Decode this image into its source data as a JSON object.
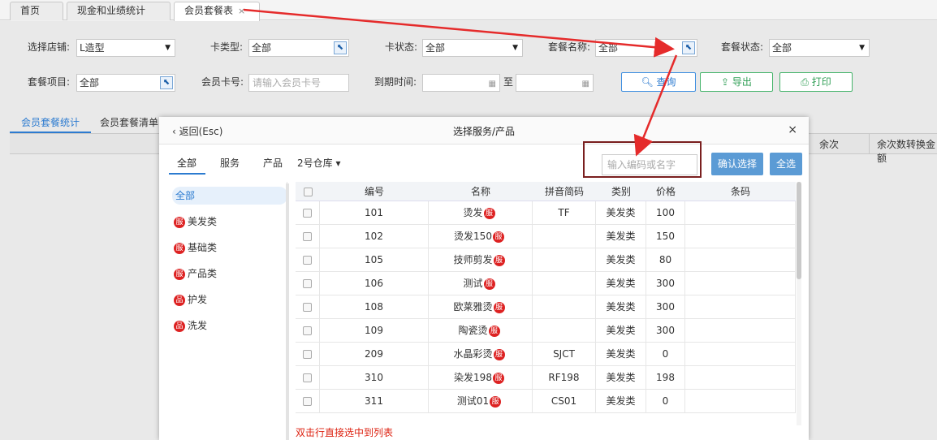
{
  "tabs": [
    {
      "label": "首页"
    },
    {
      "label": "现金和业绩统计"
    },
    {
      "label": "会员套餐表",
      "close": "×"
    }
  ],
  "filters": {
    "store_label": "选择店铺:",
    "store_value": "L造型",
    "card_type_label": "卡类型:",
    "card_type_value": "全部",
    "card_status_label": "卡状态:",
    "card_status_value": "全部",
    "package_name_label": "套餐名称:",
    "package_name_value": "全部",
    "package_status_label": "套餐状态:",
    "package_status_value": "全部",
    "package_item_label": "套餐项目:",
    "package_item_value": "全部",
    "card_no_label": "会员卡号:",
    "card_no_placeholder": "请输入会员卡号",
    "expire_label": "到期时间:",
    "to_label": "至"
  },
  "buttons": {
    "query": "查询",
    "export": "导出",
    "print": "打印"
  },
  "subtabs": [
    "会员套餐统计",
    "会员套餐清单"
  ],
  "bg_table_headers": [
    "余次",
    "余次数转换金额"
  ],
  "dialog": {
    "back": "返回(Esc)",
    "title": "选择服务/产品",
    "close": "×",
    "filter_tabs": [
      "全部",
      "服务",
      "产品"
    ],
    "warehouse": "2号仓库 ▾",
    "search_placeholder": "输入编码或名字",
    "confirm": "确认选择",
    "select_all": "全选",
    "categories": [
      {
        "label": "全部",
        "badge": ""
      },
      {
        "label": "美发类",
        "badge": "服"
      },
      {
        "label": "基础类",
        "badge": "服"
      },
      {
        "label": "产品类",
        "badge": "服"
      },
      {
        "label": "护发",
        "badge": "品"
      },
      {
        "label": "洗发",
        "badge": "品"
      }
    ],
    "columns": [
      "编号",
      "名称",
      "拼音简码",
      "类别",
      "价格",
      "条码"
    ],
    "rows": [
      {
        "code": "101",
        "name": "烫发",
        "badge": "服",
        "pinyin": "TF",
        "category": "美发类",
        "price": "100"
      },
      {
        "code": "102",
        "name": "烫发150",
        "badge": "服",
        "pinyin": "",
        "category": "美发类",
        "price": "150"
      },
      {
        "code": "105",
        "name": "技师剪发",
        "badge": "服",
        "pinyin": "",
        "category": "美发类",
        "price": "80"
      },
      {
        "code": "106",
        "name": "测试",
        "badge": "服",
        "pinyin": "",
        "category": "美发类",
        "price": "300"
      },
      {
        "code": "108",
        "name": "欧莱雅烫",
        "badge": "服",
        "pinyin": "",
        "category": "美发类",
        "price": "300"
      },
      {
        "code": "109",
        "name": "陶瓷烫",
        "badge": "服",
        "pinyin": "",
        "category": "美发类",
        "price": "300"
      },
      {
        "code": "209",
        "name": "水晶彩烫",
        "badge": "服",
        "pinyin": "SJCT",
        "category": "美发类",
        "price": "0"
      },
      {
        "code": "310",
        "name": "染发198",
        "badge": "服",
        "pinyin": "RF198",
        "category": "美发类",
        "price": "198"
      },
      {
        "code": "311",
        "name": "测试01",
        "badge": "服",
        "pinyin": "CS01",
        "category": "美发类",
        "price": "0"
      }
    ],
    "hint": "双击行直接选中到列表"
  }
}
